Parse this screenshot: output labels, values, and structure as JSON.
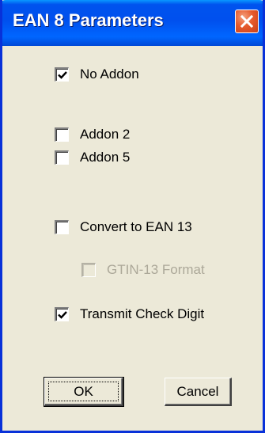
{
  "window": {
    "title": "EAN 8 Parameters"
  },
  "options": [
    {
      "label": "No Addon",
      "checked": true,
      "enabled": true
    },
    {
      "label": "Addon 2",
      "checked": false,
      "enabled": true
    },
    {
      "label": "Addon 5",
      "checked": false,
      "enabled": true
    },
    {
      "label": "Convert to EAN 13",
      "checked": false,
      "enabled": true
    },
    {
      "label": "GTIN-13 Format",
      "checked": false,
      "enabled": false
    },
    {
      "label": "Transmit Check Digit",
      "checked": true,
      "enabled": true
    }
  ],
  "buttons": {
    "ok_label": "OK",
    "cancel_label": "Cancel"
  },
  "colors": {
    "titlebar": "#0053ee",
    "dialog_bg": "#ece9d8",
    "close_button": "#e65a2c",
    "disabled_text": "#aca899"
  }
}
